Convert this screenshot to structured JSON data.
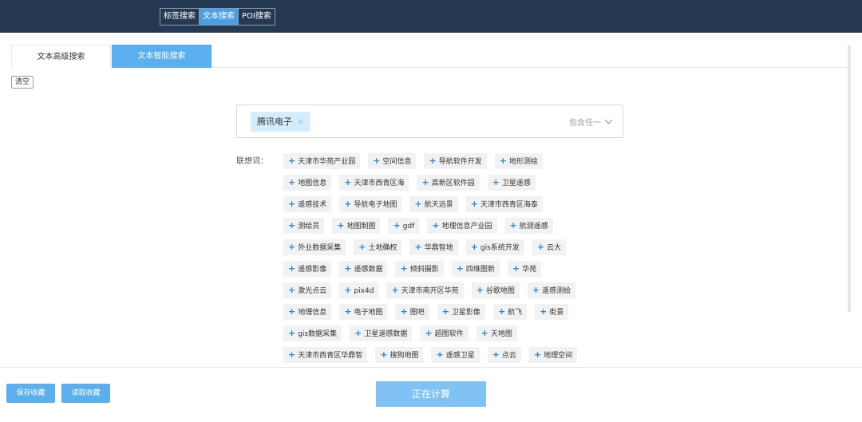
{
  "mode_tabs": [
    {
      "label": "标签搜索",
      "active": false
    },
    {
      "label": "文本搜索",
      "active": true
    },
    {
      "label": "POI搜索",
      "active": false
    }
  ],
  "sub_tabs": [
    {
      "label": "文本高级搜索",
      "active": false
    },
    {
      "label": "文本智能搜索",
      "active": true
    }
  ],
  "clear_label": "清空",
  "search": {
    "tag": "腾讯电子",
    "tag_remove": "×",
    "match_mode": "包含任一"
  },
  "association_label": "联想词：",
  "suggestion_rows": [
    [
      "天津市华苑产业园",
      "空间信息",
      "导航软件开发",
      "地形测绘"
    ],
    [
      "地图信息",
      "天津市西青区海",
      "高新区软件园",
      "卫星遥感"
    ],
    [
      "遥感技术",
      "导航电子地图",
      "航天远景",
      "天津市西青区海泰"
    ],
    [
      "测绘员",
      "地图制图",
      "gdf",
      "地理信息产业园",
      "航测遥感"
    ],
    [
      "外业数据采集",
      "土地确权",
      "华鼎智地",
      "gis系统开发",
      "云大"
    ],
    [
      "遥感影像",
      "遥感数据",
      "倾斜摄影",
      "四维图新",
      "华苑"
    ],
    [
      "激光点云",
      "pix4d",
      "天津市南开区华苑",
      "谷歌地图",
      "遥感测绘"
    ],
    [
      "地理信息",
      "电子地图",
      "图吧",
      "卫星影像",
      "航飞",
      "街景"
    ],
    [
      "gis数据采集",
      "卫星遥感数据",
      "超图软件",
      "天地图"
    ],
    [
      "天津市西青区华鼎智",
      "搜狗地图",
      "遥感卫星",
      "点云",
      "地理空间"
    ]
  ],
  "footer": {
    "save_label": "保存收藏",
    "load_label": "读取收藏",
    "compute_label": "正在计算"
  },
  "colors": {
    "topbar": "#253a52",
    "accent": "#5aafef",
    "plus": "#2d86d6"
  }
}
